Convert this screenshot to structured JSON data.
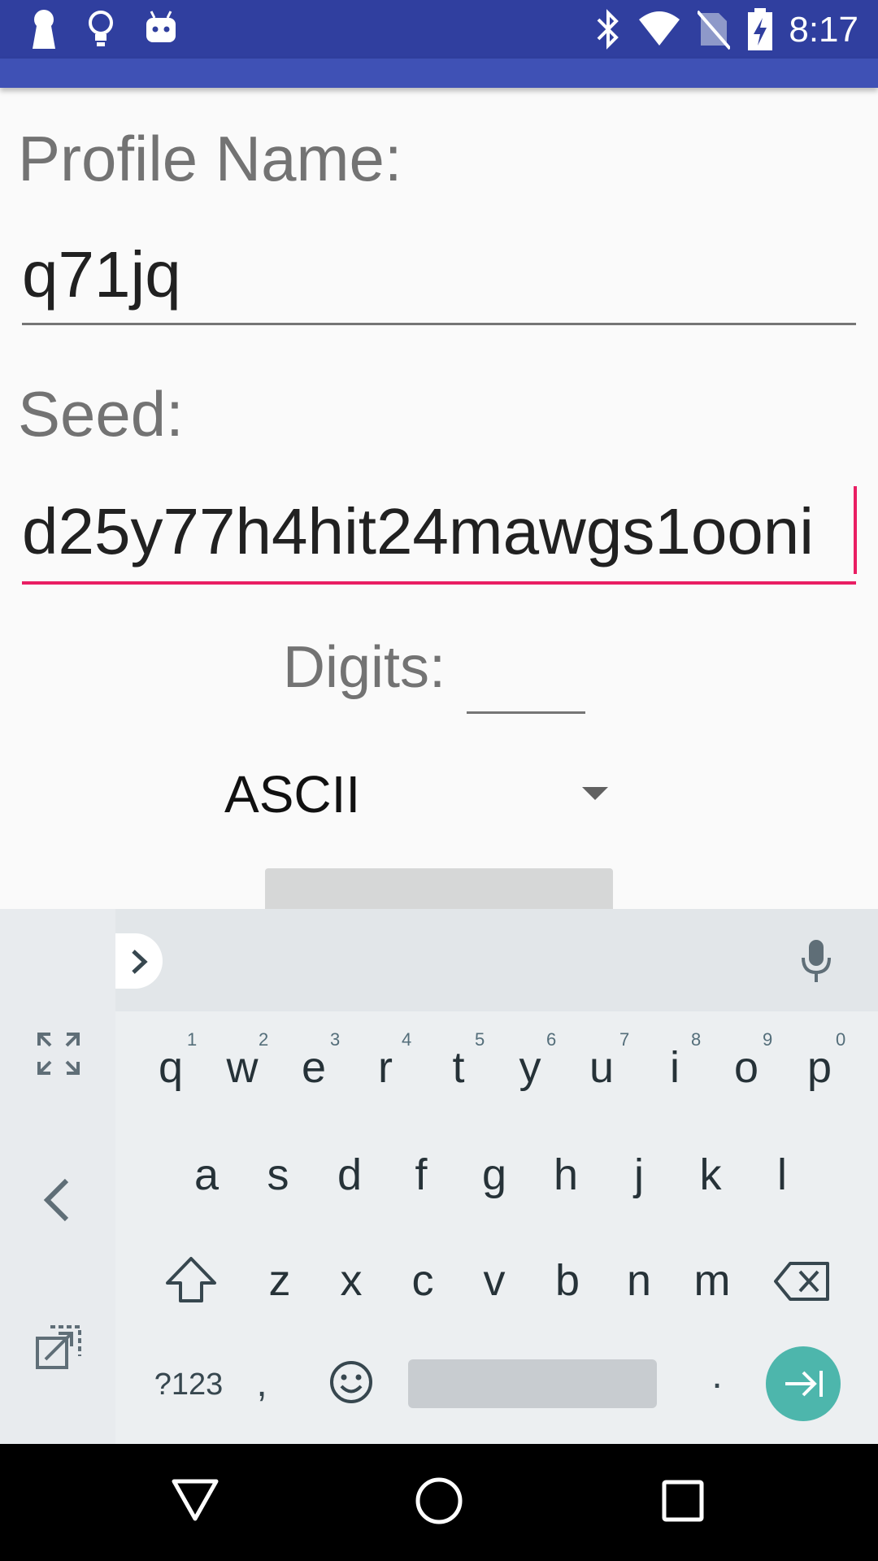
{
  "status_bar": {
    "time": "8:17",
    "icons": [
      "keyhole-icon",
      "lightbulb-icon",
      "android-icon",
      "bluetooth-icon",
      "wifi-icon",
      "no-sim-icon",
      "battery-charging-icon"
    ]
  },
  "form": {
    "profile_name_label": "Profile Name:",
    "profile_name_value": "q71jq",
    "seed_label": "Seed:",
    "seed_value": "d25y77h4hit24mawgs1ooni",
    "digits_label": "Digits:",
    "digits_value": "",
    "encoding_selected": "ASCII"
  },
  "keyboard": {
    "row1": [
      {
        "key": "q",
        "hint": "1"
      },
      {
        "key": "w",
        "hint": "2"
      },
      {
        "key": "e",
        "hint": "3"
      },
      {
        "key": "r",
        "hint": "4"
      },
      {
        "key": "t",
        "hint": "5"
      },
      {
        "key": "y",
        "hint": "6"
      },
      {
        "key": "u",
        "hint": "7"
      },
      {
        "key": "i",
        "hint": "8"
      },
      {
        "key": "o",
        "hint": "9"
      },
      {
        "key": "p",
        "hint": "0"
      }
    ],
    "row2": [
      "a",
      "s",
      "d",
      "f",
      "g",
      "h",
      "j",
      "k",
      "l"
    ],
    "row3": [
      "z",
      "x",
      "c",
      "v",
      "b",
      "n",
      "m"
    ],
    "symbols_label": "?123",
    "comma": ",",
    "period": "."
  },
  "colors": {
    "status_bar": "#303f9f",
    "app_bar": "#3f51b5",
    "accent": "#e91e63",
    "keyboard_enter": "#4db6ac"
  }
}
